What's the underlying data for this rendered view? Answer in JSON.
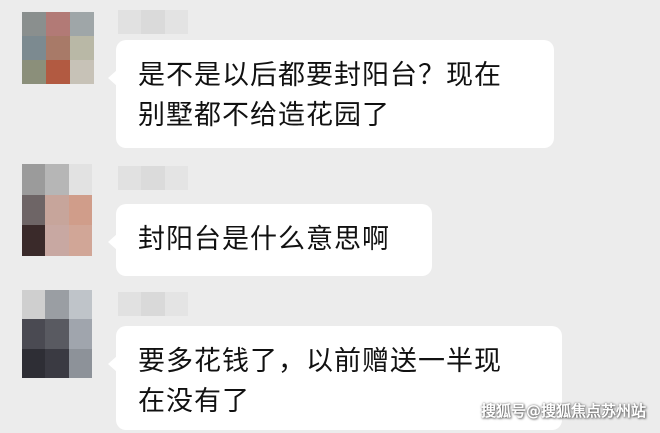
{
  "messages": [
    {
      "text_line_1": "是不是以后都要封阳台？现在",
      "text_line_2": "别墅都不给造花园了"
    },
    {
      "text_line_1": "封阳台是什么意思啊"
    },
    {
      "text_line_1": "要多花钱了，以前赠送一半现",
      "text_line_2": "在没有了"
    }
  ],
  "watermark": "搜狐号@搜狐焦点苏州站",
  "colors": {
    "background": "#ececec",
    "bubble": "#ffffff",
    "text": "#111111"
  }
}
